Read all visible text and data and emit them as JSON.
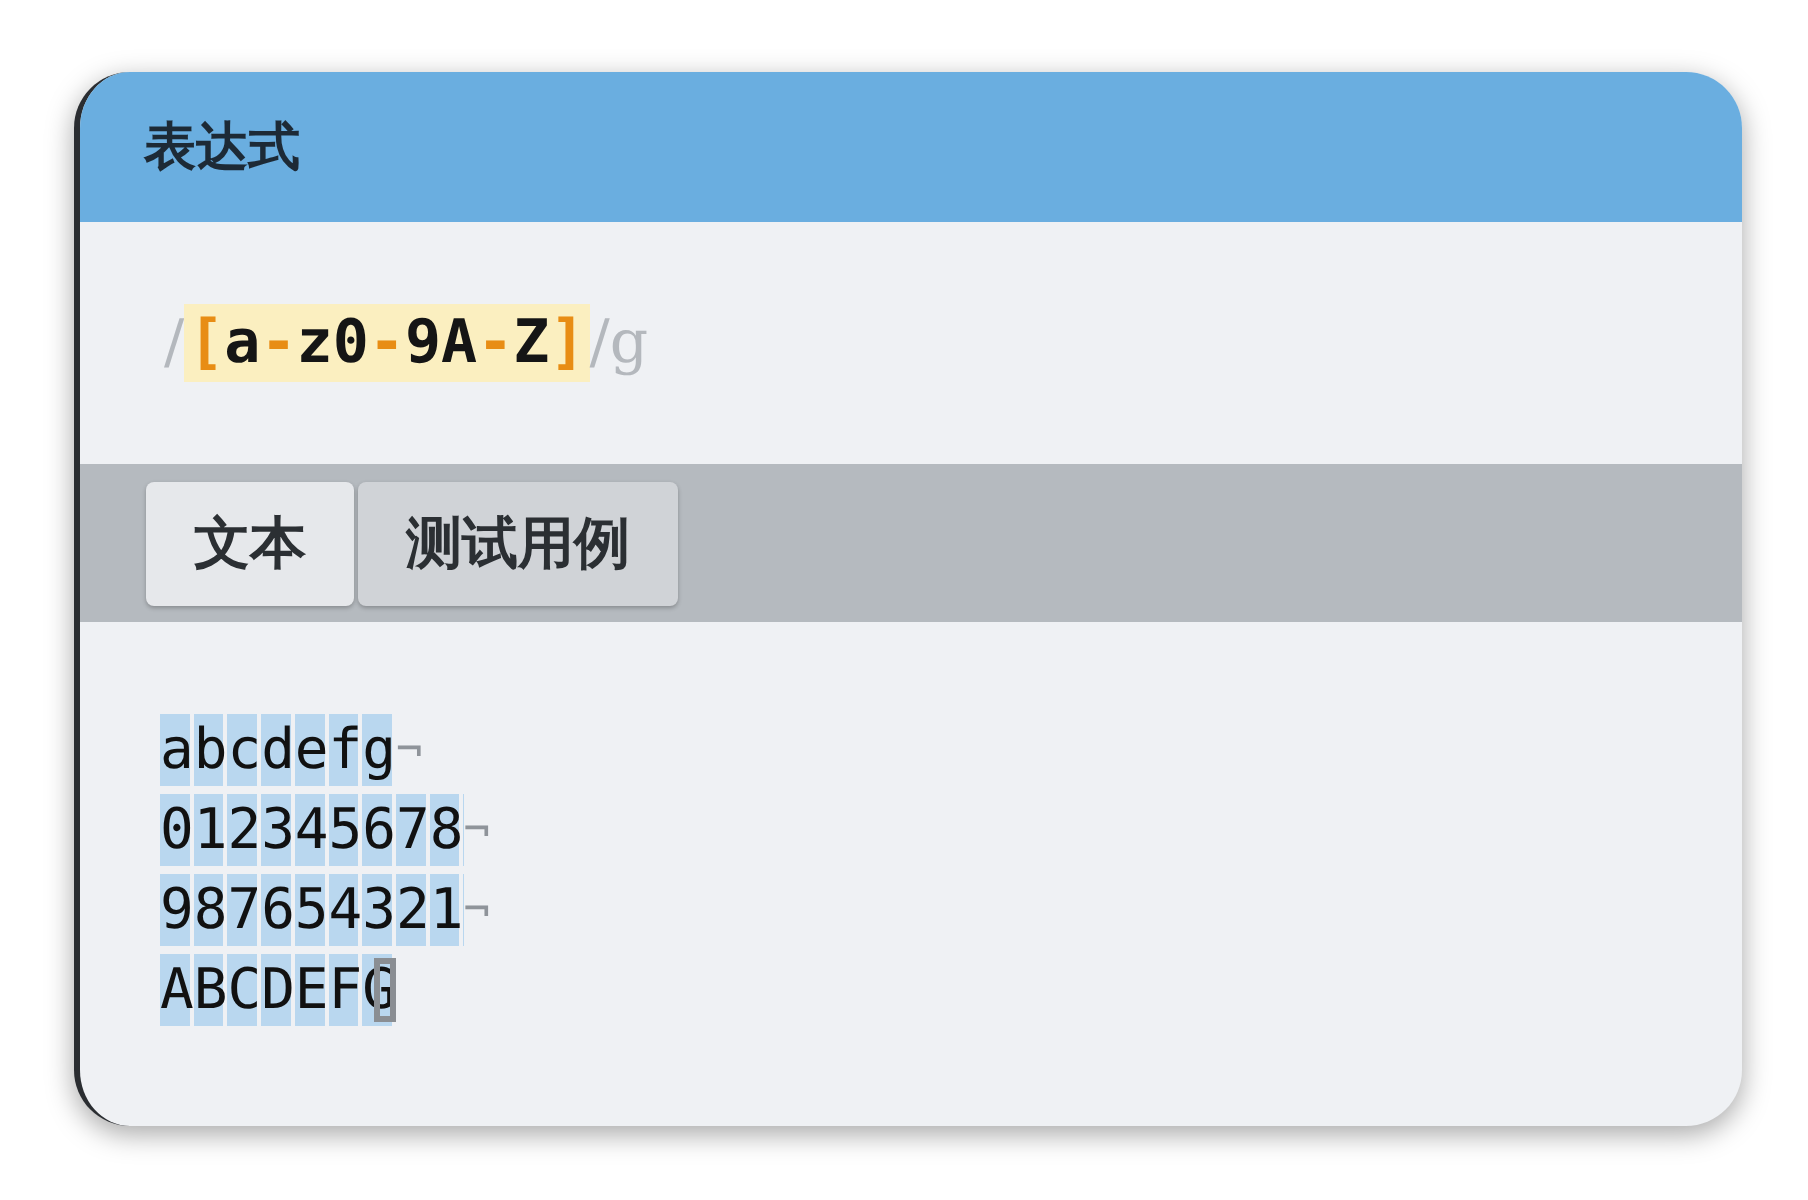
{
  "panel": {
    "title": "表达式"
  },
  "expression": {
    "delimiter_open": "/",
    "tokens": [
      {
        "text": "[",
        "kind": "bracket"
      },
      {
        "text": "a",
        "kind": "char"
      },
      {
        "text": "-",
        "kind": "range"
      },
      {
        "text": "z0",
        "kind": "char"
      },
      {
        "text": "-",
        "kind": "range"
      },
      {
        "text": "9A",
        "kind": "char"
      },
      {
        "text": "-",
        "kind": "range"
      },
      {
        "text": "Z",
        "kind": "char"
      },
      {
        "text": "]",
        "kind": "bracket"
      }
    ],
    "delimiter_close": "/",
    "flags": "g"
  },
  "tabs": [
    {
      "label": "文本",
      "selected": true
    },
    {
      "label": "测试用例",
      "selected": false
    }
  ],
  "text_lines": [
    {
      "text": "abcdefg",
      "eol": "¬",
      "caret": false
    },
    {
      "text": "012345678",
      "eol": "¬",
      "caret": false
    },
    {
      "text": "987654321",
      "eol": "¬",
      "caret": false
    },
    {
      "text": "ABCDEFG",
      "caret": true
    }
  ]
}
